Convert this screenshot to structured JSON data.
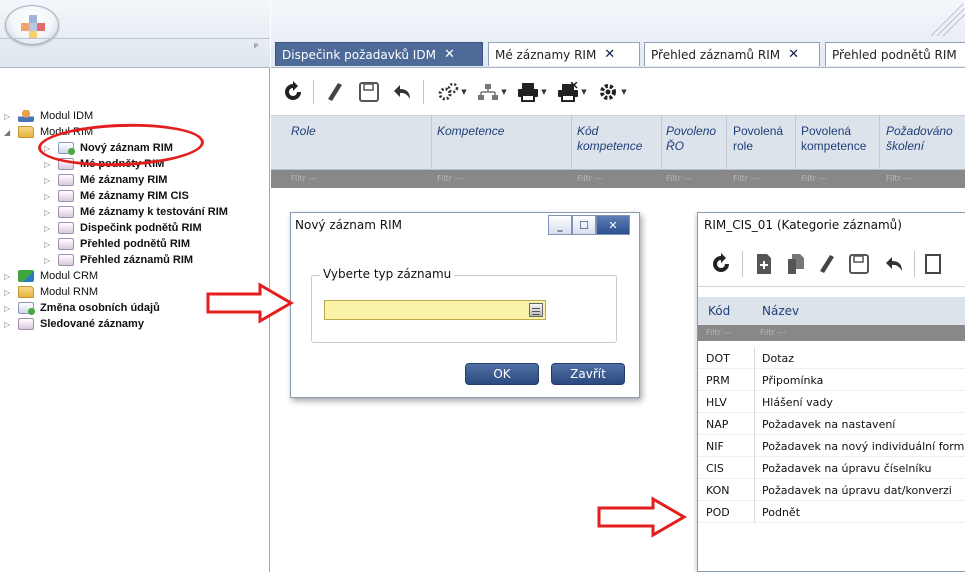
{
  "sidebar": {
    "items": [
      {
        "label": "Modul IDM",
        "icon": "person-icon",
        "bold": false,
        "expanded": false
      },
      {
        "label": "Modul RIM",
        "icon": "folder-icon",
        "bold": false,
        "expanded": true
      },
      {
        "label": "Nový záznam RIM",
        "icon": "new-record-icon",
        "bold": true
      },
      {
        "label": "Mé podněty RIM",
        "icon": "database-icon",
        "bold": true
      },
      {
        "label": "Mé záznamy RIM",
        "icon": "database-icon",
        "bold": true
      },
      {
        "label": "Mé záznamy RIM CIS",
        "icon": "database-icon",
        "bold": true
      },
      {
        "label": "Mé záznamy k testování RIM",
        "icon": "database-icon",
        "bold": true
      },
      {
        "label": "Dispečink podnětů RIM",
        "icon": "database-icon",
        "bold": true
      },
      {
        "label": "Přehled podnětů RIM",
        "icon": "database-icon",
        "bold": true
      },
      {
        "label": "Přehled záznamů RIM",
        "icon": "database-icon",
        "bold": true
      },
      {
        "label": "Modul CRM",
        "icon": "crm-icon",
        "bold": false
      },
      {
        "label": "Modul RNM",
        "icon": "folder-icon",
        "bold": false
      },
      {
        "label": "Změna osobních údajů",
        "icon": "new-record-icon",
        "bold": true
      },
      {
        "label": "Sledované záznamy",
        "icon": "database-icon",
        "bold": true
      }
    ],
    "pin_glyph": "ᵖ"
  },
  "tabs": [
    {
      "label": "Dispečink požadavků IDM",
      "active": true,
      "close": "✕"
    },
    {
      "label": "Mé záznamy RIM",
      "active": false,
      "close": "✕"
    },
    {
      "label": "Přehled záznamů RIM",
      "active": false,
      "close": "✕"
    },
    {
      "label": "Přehled podnětů RIM",
      "active": false,
      "close": ""
    }
  ],
  "grid": {
    "columns": [
      "Role",
      "Kompetence",
      "Kód kompetence",
      "Povoleno ŘO",
      "Povolená role",
      "Povolená kompetence",
      "Požadováno školení"
    ],
    "filter_placeholder": "Filtr ---"
  },
  "dialog": {
    "title": "Nový záznam RIM",
    "minimize": "_",
    "maximize": "☐",
    "close": "✕",
    "group_label": "Vyberte typ záznamu",
    "combo_value": "",
    "ok_label": "OK",
    "close_label": "Zavřít"
  },
  "cis": {
    "title": "RIM_CIS_01 (Kategorie záznamů)",
    "columns": {
      "code": "Kód",
      "name": "Název"
    },
    "filter_placeholder": "Filtr ---",
    "rows": [
      {
        "code": "DOT",
        "name": "Dotaz"
      },
      {
        "code": "PRM",
        "name": "Připomínka"
      },
      {
        "code": "HLV",
        "name": "Hlášení vady"
      },
      {
        "code": "NAP",
        "name": "Požadavek na nastavení"
      },
      {
        "code": "NIF",
        "name": "Požadavek na nový individuální formulá"
      },
      {
        "code": "CIS",
        "name": "Požadavek na úpravu číselníku"
      },
      {
        "code": "KON",
        "name": "Požadavek na úpravu dat/konverzi"
      },
      {
        "code": "POD",
        "name": "Podnět"
      }
    ]
  },
  "colors": {
    "active_tab": "#4d6a98",
    "annotation_red": "#e41d1d",
    "combo_bg": "#fbf4a8",
    "button_blue": "#2b4a80"
  }
}
